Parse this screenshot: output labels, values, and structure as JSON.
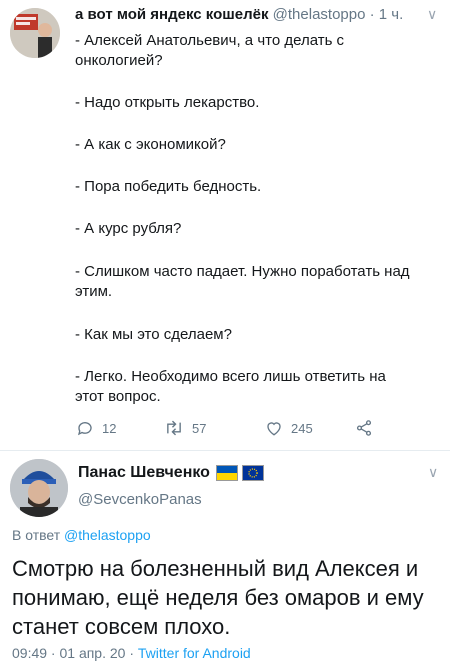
{
  "quoted_tweet": {
    "display_name": "а вот мой яндекс кошелёк",
    "handle": "@thelastoppo",
    "time": "1 ч.",
    "lines": [
      "- Алексей Анатольевич, а что делать с",
      "онкологией?",
      "- Надо открыть лекарство.",
      "- А как с экономикой?",
      "- Пора победить бедность.",
      "- А курс рубля?",
      "- Слишком часто падает. Нужно поработать над",
      "этим.",
      "- Как мы это сделаем?",
      "- Легко. Необходимо всего лишь ответить на",
      "этот вопрос."
    ],
    "actions": {
      "replies": "12",
      "retweets": "57",
      "likes": "245"
    }
  },
  "reply_tweet": {
    "display_name": "Панас Шевченко",
    "handle": "@SevcenkoPanas",
    "reply_prefix": "В ответ",
    "reply_handle": "@thelastoppo",
    "lines": [
      "Смотрю на болезненный вид Алексея и",
      "понимаю, ещё неделя без омаров и ему",
      "станет совсем плохо."
    ],
    "meta_datetime": "09:49 · 01 апр. 20 · ",
    "meta_client": "Twitter for Android"
  },
  "colors": {
    "link_blue": "#1da1f2",
    "secondary_gray": "#657786",
    "divider": "#e6ecf0"
  }
}
